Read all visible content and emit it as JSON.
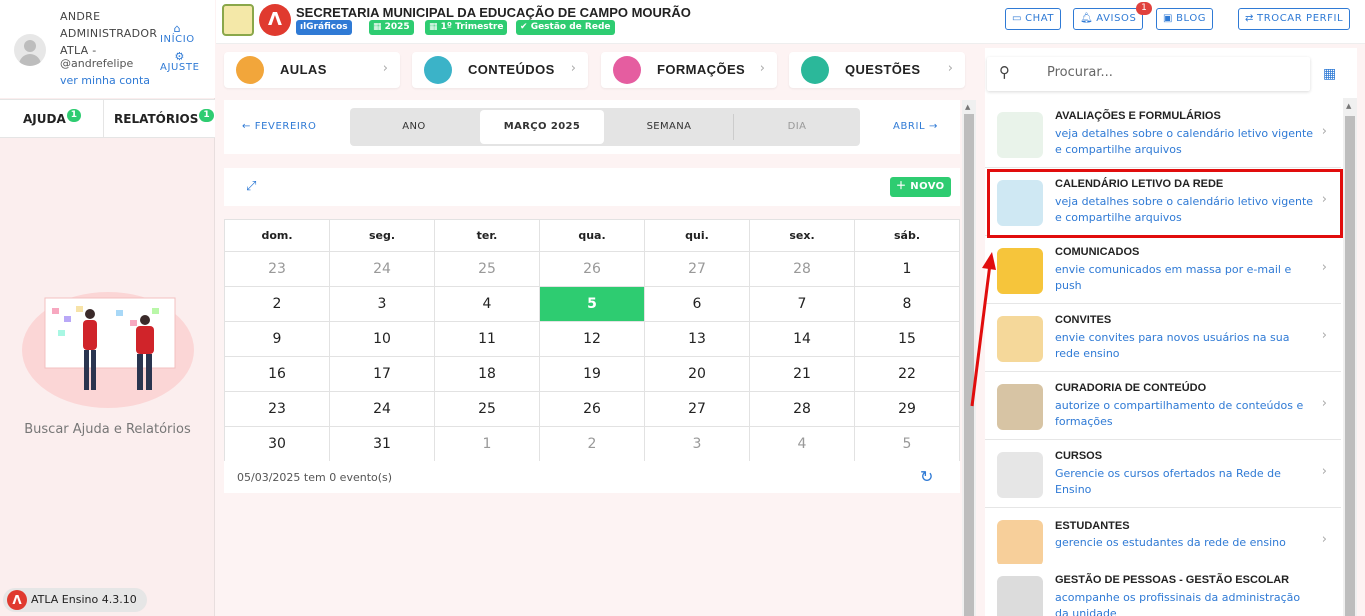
{
  "user": {
    "name": "ANDRE ADMINISTRADOR ATLA -",
    "handle": "@andrefelipe",
    "account_link": "ver minha conta",
    "home_link": "INÍCIO",
    "settings_link": "AJUSTE"
  },
  "side_tabs": {
    "help": "AJUDA",
    "help_badge": "1",
    "reports": "RELATÓRIOS",
    "reports_badge": "1"
  },
  "help_caption": "Buscar Ajuda e Relatórios",
  "version": "ATLA Ensino 4.3.10",
  "header": {
    "title": "SECRETARIA MUNICIPAL DA EDUCAÇÃO DE CAMPO MOURÃO",
    "chips": [
      "Gráficos",
      "2025",
      "1º Trimestre",
      "Gestão de Rede"
    ],
    "chat": "CHAT",
    "notices": "AVISOS",
    "notices_badge": "1",
    "blog": "BLOG",
    "switch_profile": "TROCAR PERFIL"
  },
  "categories": [
    "AULAS",
    "CONTEÚDOS",
    "FORMAÇÕES",
    "QUESTÕES"
  ],
  "calendar": {
    "prev": "FEVEREIRO",
    "next": "ABRIL",
    "views": [
      "ANO",
      "MARÇO 2025",
      "SEMANA",
      "DIA"
    ],
    "new_button": "NOVO",
    "weekdays": [
      "dom.",
      "seg.",
      "ter.",
      "qua.",
      "qui.",
      "sex.",
      "sáb."
    ],
    "weeks": [
      [
        "23",
        "24",
        "25",
        "26",
        "27",
        "28",
        "1"
      ],
      [
        "2",
        "3",
        "4",
        "5",
        "6",
        "7",
        "8"
      ],
      [
        "9",
        "10",
        "11",
        "12",
        "13",
        "14",
        "15"
      ],
      [
        "16",
        "17",
        "18",
        "19",
        "20",
        "21",
        "22"
      ],
      [
        "23",
        "24",
        "25",
        "26",
        "27",
        "28",
        "29"
      ],
      [
        "30",
        "31",
        "1",
        "2",
        "3",
        "4",
        "5"
      ]
    ],
    "today": "5",
    "events_text": "05/03/2025 tem 0 evento(s)"
  },
  "panel": {
    "search_placeholder": "Procurar...",
    "items": [
      {
        "title": "AVALIAÇÕES E FORMULÁRIOS",
        "desc": "veja detalhes sobre o calendário letivo vigente e compartilhe arquivos"
      },
      {
        "title": "CALENDÁRIO LETIVO DA REDE",
        "desc": "veja detalhes sobre o calendário letivo vigente e compartilhe arquivos"
      },
      {
        "title": "COMUNICADOS",
        "desc": "envie comunicados em massa por e-mail e push"
      },
      {
        "title": "CONVITES",
        "desc": "envie convites para novos usuários na sua rede ensino"
      },
      {
        "title": "CURADORIA DE CONTEÚDO",
        "desc": "autorize o compartilhamento de conteúdos e formações"
      },
      {
        "title": "CURSOS",
        "desc": "Gerencie os cursos ofertados na Rede de Ensino"
      },
      {
        "title": "ESTUDANTES",
        "desc": "gerencie os estudantes da rede de ensino"
      },
      {
        "title": "GESTÃO DE PESSOAS - GESTÃO ESCOLAR",
        "desc": "acompanhe os profissinais da administração da unidade"
      }
    ]
  },
  "colors": {
    "accent": "#2f7ad5",
    "success": "#2ecc71",
    "highlight": "#e10d0d",
    "brand": "#e03a2f"
  }
}
